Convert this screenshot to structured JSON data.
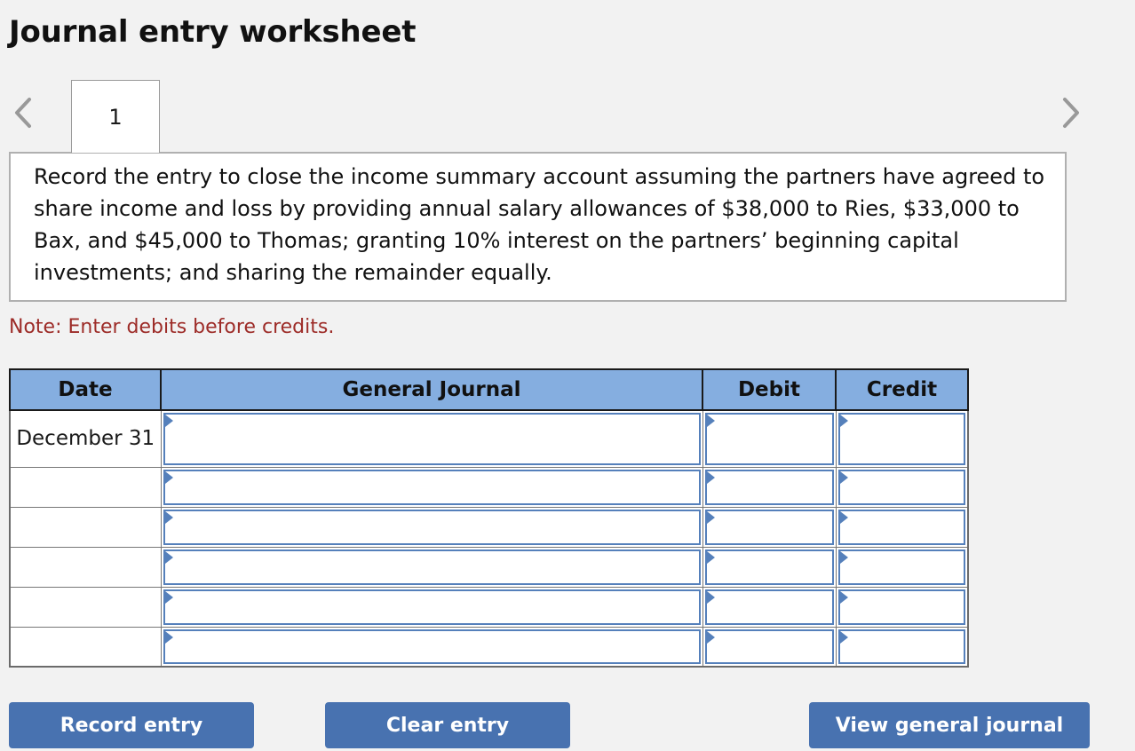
{
  "page": {
    "title": "Journal entry worksheet",
    "note": "Note: Enter debits before credits.",
    "colors": {
      "background": "#f2f2f2",
      "header_blue": "#85aee0",
      "button_blue": "#4872b0",
      "note_red": "#9d2c28",
      "field_border_blue": "#5580bb"
    }
  },
  "nav": {
    "prev_icon": "chevron-left-icon",
    "next_icon": "chevron-right-icon"
  },
  "tabs": [
    {
      "label": "1",
      "selected": true
    }
  ],
  "description": {
    "text": "Record the entry to close the income summary account assuming the partners have agreed to share income and loss by providing annual salary allowances of $38,000 to Ries, $33,000 to Bax, and $45,000 to Thomas; granting 10% interest on the partners’ beginning capital investments; and sharing the remainder equally."
  },
  "table": {
    "columns": [
      "Date",
      "General Journal",
      "Debit",
      "Credit"
    ],
    "rows": [
      {
        "date": "December 31",
        "general_journal": "",
        "debit": "",
        "credit": ""
      },
      {
        "date": "",
        "general_journal": "",
        "debit": "",
        "credit": ""
      },
      {
        "date": "",
        "general_journal": "",
        "debit": "",
        "credit": ""
      },
      {
        "date": "",
        "general_journal": "",
        "debit": "",
        "credit": ""
      },
      {
        "date": "",
        "general_journal": "",
        "debit": "",
        "credit": ""
      },
      {
        "date": "",
        "general_journal": "",
        "debit": "",
        "credit": ""
      }
    ]
  },
  "buttons": {
    "record": "Record entry",
    "clear": "Clear entry",
    "view": "View general journal"
  }
}
